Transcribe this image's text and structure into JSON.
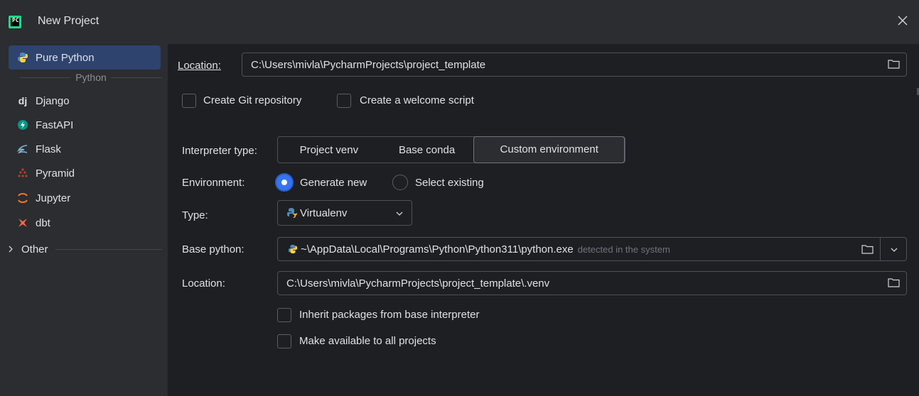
{
  "window": {
    "title": "New Project"
  },
  "sidebar": {
    "items": [
      {
        "label": "Pure Python",
        "icon": "python-icon",
        "selected": true
      },
      {
        "label": "Django",
        "icon": "django-icon"
      },
      {
        "label": "FastAPI",
        "icon": "fastapi-icon"
      },
      {
        "label": "Flask",
        "icon": "flask-icon"
      },
      {
        "label": "Pyramid",
        "icon": "pyramid-icon"
      },
      {
        "label": "Jupyter",
        "icon": "jupyter-icon"
      },
      {
        "label": "dbt",
        "icon": "dbt-icon"
      }
    ],
    "group_label": "Python",
    "other_label": "Other"
  },
  "form": {
    "location_label": "Location:",
    "location_value": "C:\\Users\\mivla\\PycharmProjects\\project_template",
    "create_git_label": "Create Git repository",
    "welcome_script_label": "Create a welcome script",
    "interpreter_type_label": "Interpreter type:",
    "interpreter_options": [
      "Project venv",
      "Base conda",
      "Custom environment"
    ],
    "interpreter_selected": "Custom environment",
    "environment_label": "Environment:",
    "env_generate_label": "Generate new",
    "env_select_label": "Select existing",
    "type_label": "Type:",
    "type_value": "Virtualenv",
    "base_python_label": "Base python:",
    "base_python_value": "~\\AppData\\Local\\Programs\\Python\\Python311\\python.exe",
    "base_python_hint": "detected in the system",
    "venv_location_label": "Location:",
    "venv_location_value": "C:\\Users\\mivla\\PycharmProjects\\project_template\\.venv",
    "inherit_label": "Inherit packages from base interpreter",
    "make_available_label": "Make available to all projects"
  },
  "colors": {
    "accent": "#3574f0",
    "selection": "#2e436e",
    "background": "#1e1f22",
    "sidebar": "#2b2d30"
  }
}
